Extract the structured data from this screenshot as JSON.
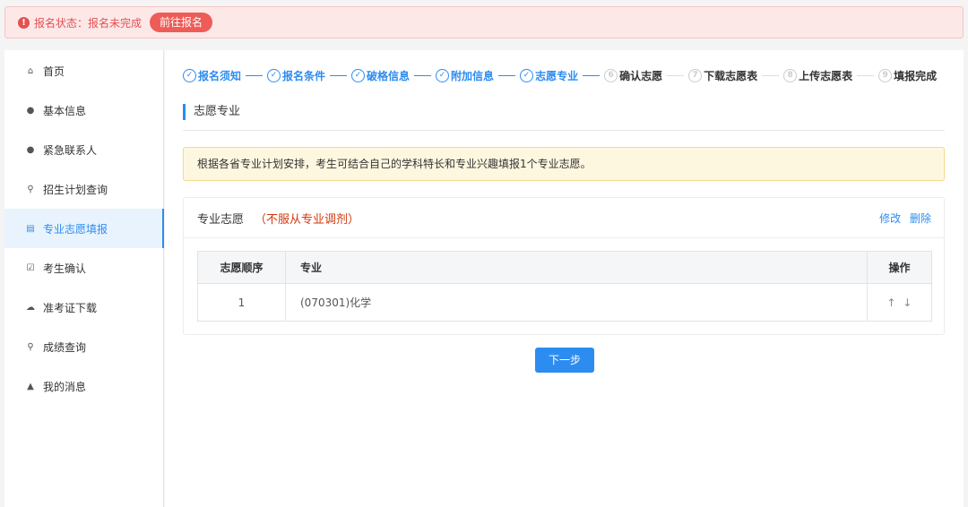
{
  "alert": {
    "text": "报名状态：报名未完成",
    "button": "前往报名",
    "icon": "info-circle-icon"
  },
  "sidebar": {
    "items": [
      {
        "label": "首页",
        "icon": "home-icon"
      },
      {
        "label": "基本信息",
        "icon": "user-icon"
      },
      {
        "label": "紧急联系人",
        "icon": "user-icon"
      },
      {
        "label": "招生计划查询",
        "icon": "search-icon"
      },
      {
        "label": "专业志愿填报",
        "icon": "form-icon",
        "active": true
      },
      {
        "label": "考生确认",
        "icon": "checkbox-icon"
      },
      {
        "label": "准考证下载",
        "icon": "cloud-download-icon"
      },
      {
        "label": "成绩查询",
        "icon": "search-icon"
      },
      {
        "label": "我的消息",
        "icon": "bell-icon"
      }
    ]
  },
  "steps": [
    {
      "num": "1",
      "label": "报名须知",
      "status": "done"
    },
    {
      "num": "2",
      "label": "报名条件",
      "status": "done"
    },
    {
      "num": "3",
      "label": "破格信息",
      "status": "done"
    },
    {
      "num": "4",
      "label": "附加信息",
      "status": "done"
    },
    {
      "num": "5",
      "label": "志愿专业",
      "status": "done"
    },
    {
      "num": "6",
      "label": "确认志愿",
      "status": "todo"
    },
    {
      "num": "7",
      "label": "下载志愿表",
      "status": "todo"
    },
    {
      "num": "8",
      "label": "上传志愿表",
      "status": "todo"
    },
    {
      "num": "9",
      "label": "填报完成",
      "status": "todo"
    }
  ],
  "main": {
    "section_title": "志愿专业",
    "tip": "根据各省专业计划安排，考生可结合自己的学科特长和专业兴趣填报1个专业志愿。",
    "panel": {
      "title": "专业志愿",
      "subtitle": "（不服从专业调剂）",
      "edit": "修改",
      "delete": "删除",
      "table": {
        "headers": [
          "志愿顺序",
          "专业",
          "操作"
        ],
        "rows": [
          {
            "order": "1",
            "major": "(070301)化学",
            "up": "↑",
            "down": "↓"
          }
        ]
      }
    },
    "next_button": "下一步"
  },
  "colors": {
    "primary": "#2d8cf0",
    "alert_bg": "#fde8e8",
    "alert_text": "#e35151",
    "tip_bg": "#fef7e0",
    "subtitle": "#d4380d"
  }
}
